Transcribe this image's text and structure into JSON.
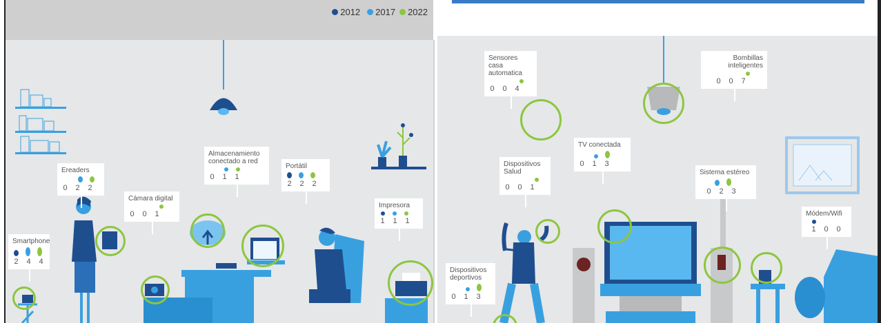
{
  "legend": {
    "items": [
      {
        "label": "2012",
        "color": "#1f4e8f"
      },
      {
        "label": "2017",
        "color": "#39a0e0"
      },
      {
        "label": "2022",
        "color": "#8cc63f"
      }
    ]
  },
  "devices_left": [
    {
      "title": "Smartphone",
      "v2012": "2",
      "v2017": "4",
      "v2022": "4"
    },
    {
      "title": "Ereaders",
      "v2012": "0",
      "v2017": "2",
      "v2022": "2"
    },
    {
      "title": "Cámara digital",
      "v2012": "0",
      "v2017": "0",
      "v2022": "1"
    },
    {
      "title": "Almacenamiento\nconectado a red",
      "v2012": "0",
      "v2017": "1",
      "v2022": "1"
    },
    {
      "title": "Portátil",
      "v2012": "2",
      "v2017": "2",
      "v2022": "2"
    },
    {
      "title": "Impresora",
      "v2012": "1",
      "v2017": "1",
      "v2022": "1"
    }
  ],
  "devices_right": [
    {
      "title": "Sensores casa\nautomatica",
      "v2012": "0",
      "v2017": "0",
      "v2022": "4"
    },
    {
      "title": "Bombillas\ninteligentes",
      "v2012": "0",
      "v2017": "0",
      "v2022": "7"
    },
    {
      "title": "TV conectada",
      "v2012": "0",
      "v2017": "1",
      "v2022": "3"
    },
    {
      "title": "Dispositivos\nSalud",
      "v2012": "0",
      "v2017": "0",
      "v2022": "1"
    },
    {
      "title": "Sistema estéreo",
      "v2012": "0",
      "v2017": "2",
      "v2022": "3"
    },
    {
      "title": "Módem/Wifi",
      "v2012": "1",
      "v2017": "0",
      "v2022": "0"
    },
    {
      "title": "Dispositivos\ndeportivos",
      "v2012": "0",
      "v2017": "1",
      "v2022": "3"
    }
  ]
}
